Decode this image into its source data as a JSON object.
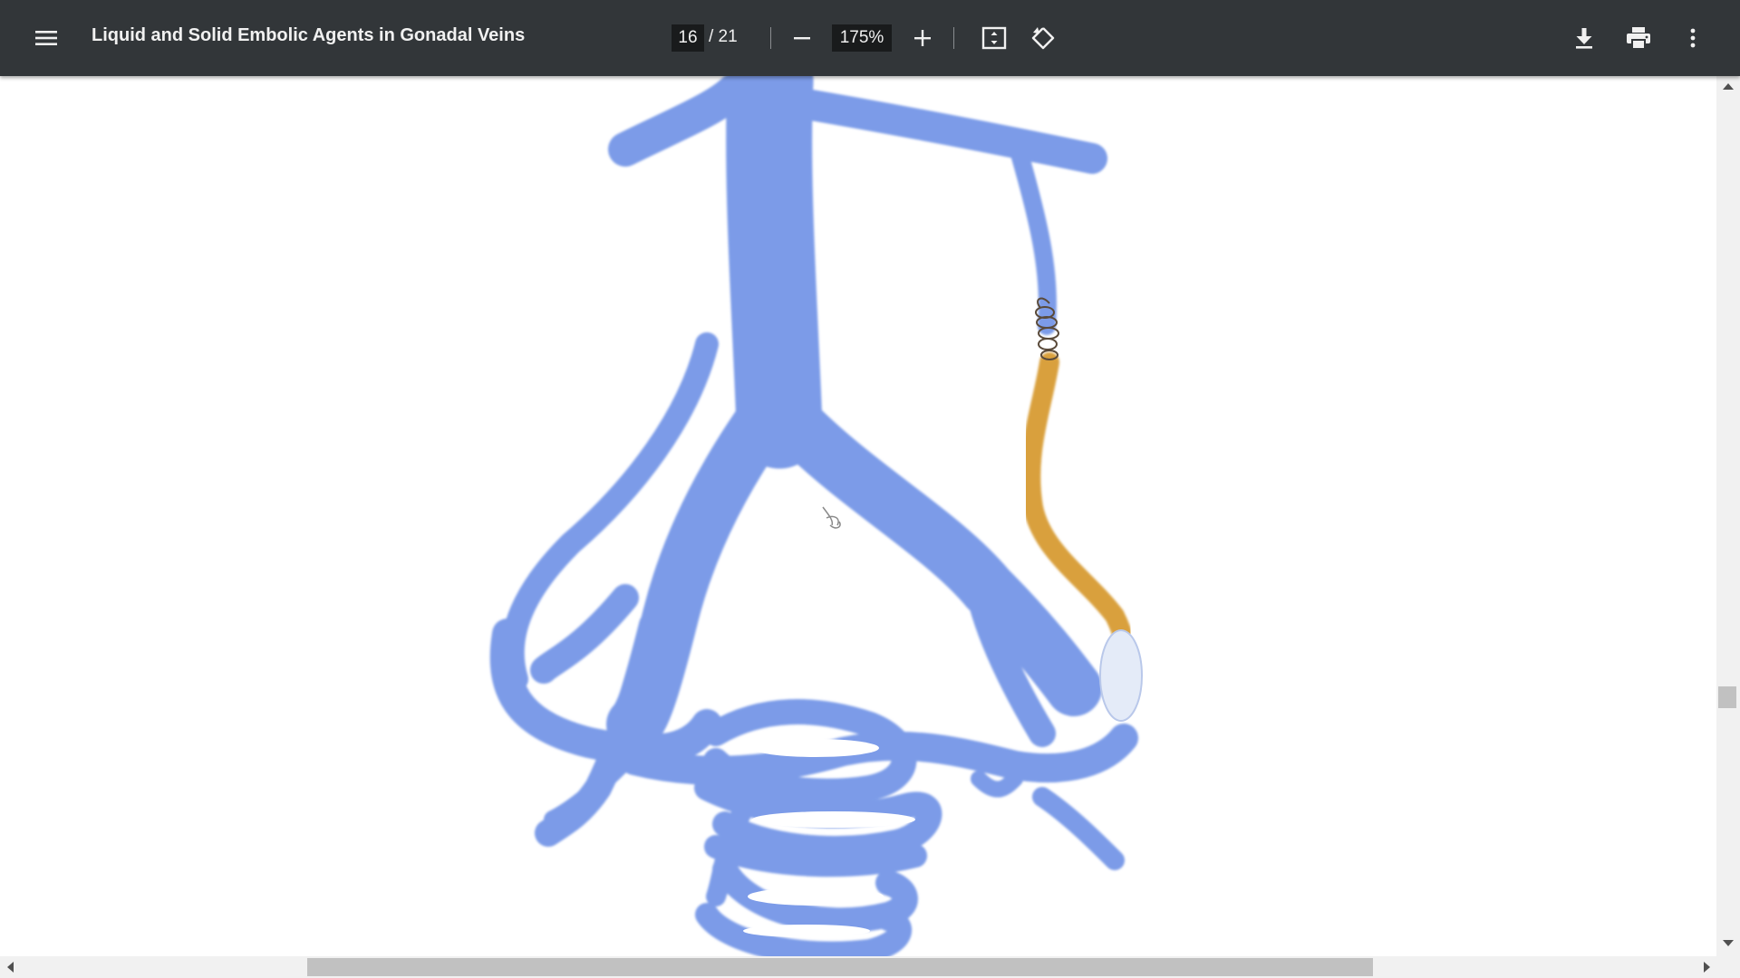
{
  "toolbar": {
    "title": "Liquid and Solid Embolic Agents in Gonadal Veins",
    "current_page": "16",
    "page_separator": "/ 21",
    "zoom_value": "175%",
    "menu_icon": "hamburger-menu-icon",
    "zoom_out_icon": "minus-icon",
    "zoom_in_icon": "plus-icon",
    "fit_icon": "fit-to-page-icon",
    "rotate_icon": "rotate-counterclockwise-icon",
    "download_icon": "download-icon",
    "print_icon": "print-icon",
    "more_icon": "more-vertical-icon"
  },
  "document": {
    "illustration": "pelvic venous anatomy with coil and liquid embolic agent in gonadal vein",
    "colors": {
      "vein": "#7b9be8",
      "embolic_agent": "#d9a03c",
      "coil": "#5a4a3a"
    }
  },
  "scrollbars": {
    "vertical_position": 0.72,
    "horizontal_position": 0.18
  }
}
